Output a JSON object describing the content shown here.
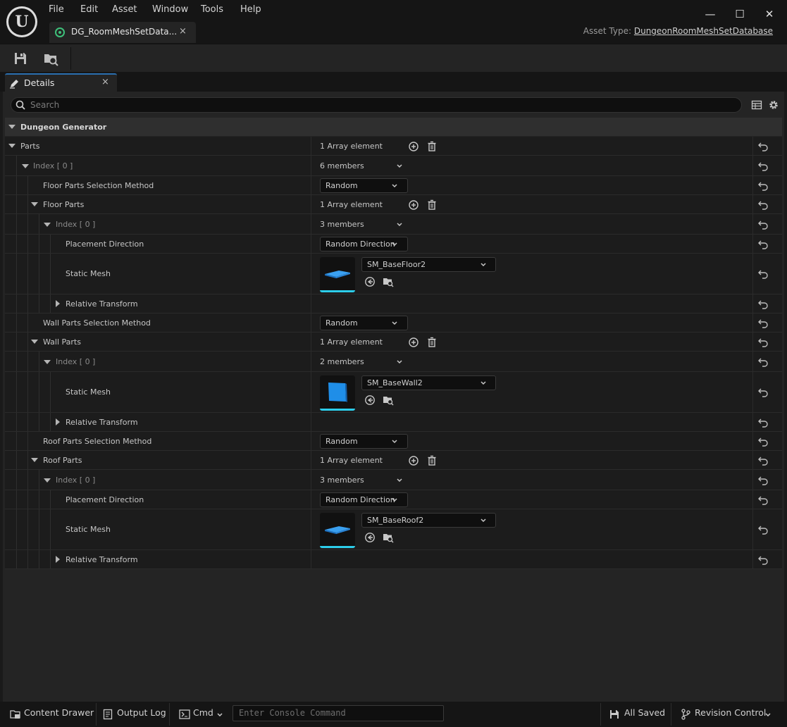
{
  "window": {
    "menu": [
      "File",
      "Edit",
      "Asset",
      "Window",
      "Tools",
      "Help"
    ],
    "logo_glyph": "U",
    "minimize": "—",
    "maximize": "☐",
    "close": "✕"
  },
  "doc_tab": {
    "label": "DG_RoomMeshSetData...",
    "close": "×"
  },
  "asset_type": {
    "label": "Asset Type:",
    "value": "DungeonRoomMeshSetDatabase"
  },
  "details_tab": {
    "label": "Details",
    "close": "×"
  },
  "search": {
    "placeholder": "Search"
  },
  "category": {
    "label": "Dungeon Generator"
  },
  "rows": {
    "parts": {
      "name": "Parts",
      "value": "1 Array element"
    },
    "idx0": {
      "name": "Index [ 0 ]",
      "value": "6 members"
    },
    "floor_sel": {
      "name": "Floor Parts Selection Method",
      "value": "Random"
    },
    "floor_parts": {
      "name": "Floor Parts",
      "value": "1 Array element"
    },
    "floor_idx": {
      "name": "Index [ 0 ]",
      "value": "3 members"
    },
    "floor_place": {
      "name": "Placement Direction",
      "value": "Random Direction"
    },
    "floor_mesh": {
      "name": "Static Mesh",
      "value": "SM_BaseFloor2"
    },
    "floor_rel": {
      "name": "Relative Transform"
    },
    "wall_sel": {
      "name": "Wall Parts Selection Method",
      "value": "Random"
    },
    "wall_parts": {
      "name": "Wall Parts",
      "value": "1 Array element"
    },
    "wall_idx": {
      "name": "Index [ 0 ]",
      "value": "2 members"
    },
    "wall_mesh": {
      "name": "Static Mesh",
      "value": "SM_BaseWall2"
    },
    "wall_rel": {
      "name": "Relative Transform"
    },
    "roof_sel": {
      "name": "Roof Parts Selection Method",
      "value": "Random"
    },
    "roof_parts": {
      "name": "Roof Parts",
      "value": "1 Array element"
    },
    "roof_idx": {
      "name": "Index [ 0 ]",
      "value": "3 members"
    },
    "roof_place": {
      "name": "Placement Direction",
      "value": "Random Direction"
    },
    "roof_mesh": {
      "name": "Static Mesh",
      "value": "SM_BaseRoof2"
    },
    "roof_rel": {
      "name": "Relative Transform"
    }
  },
  "statusbar": {
    "content_drawer": "Content Drawer",
    "output_log": "Output Log",
    "cmd": "Cmd",
    "console_placeholder": "Enter Console Command",
    "all_saved": "All Saved",
    "revision_control": "Revision Control"
  },
  "colors": {
    "accent_tab": "#2a6fb0",
    "mesh_underline": "#2ccdea",
    "asset_icon": "#3ec07a",
    "mesh_blue": "#1f8ee8"
  }
}
